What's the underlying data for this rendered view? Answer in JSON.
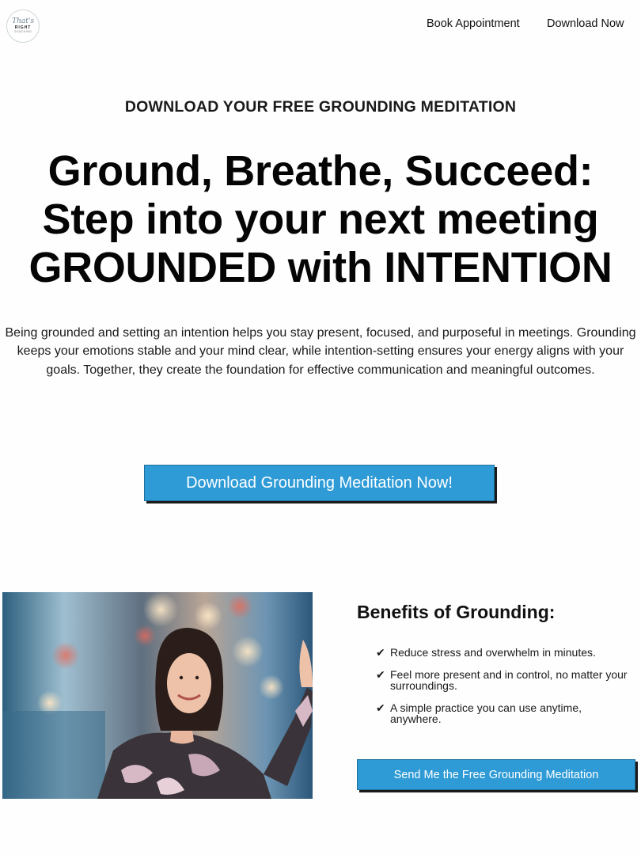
{
  "nav": {
    "logo": {
      "script": "That's",
      "caps": "RIGHT",
      "sub": "COACHING"
    },
    "links": [
      "Book Appointment",
      "Download Now"
    ]
  },
  "hero": {
    "eyebrow": "DOWNLOAD YOUR FREE GROUNDING MEDITATION",
    "headline": [
      "Ground, Breathe, Succeed:",
      "Step into your next meeting",
      "GROUNDED with INTENTION"
    ],
    "body": "Being grounded and setting an intention helps you stay present, focused, and purposeful in meetings. Grounding keeps your emotions stable and your mind clear, while intention-setting ensures your energy aligns with your goals. Together, they create the foundation for effective communication and meaningful outcomes.",
    "cta_label": "Download Grounding Meditation Now!"
  },
  "benefits": {
    "title": "Benefits of Grounding:",
    "check_icon": "✔",
    "items": [
      "Reduce stress and overwhelm in minutes.",
      "Feel more present and in control, no matter your surroundings.",
      "A simple practice you can use anytime, anywhere."
    ],
    "cta_label": "Send Me the Free Grounding Meditation"
  },
  "colors": {
    "accent": "#2e9bd6",
    "shadow": "#1a1a1a"
  }
}
